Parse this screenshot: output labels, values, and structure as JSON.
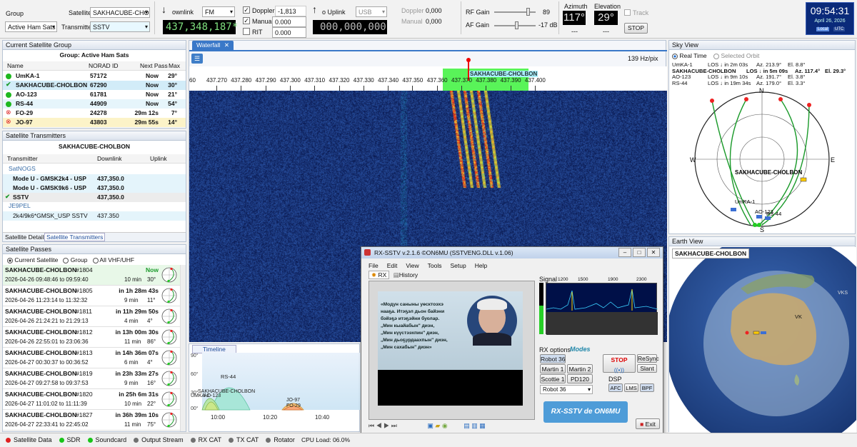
{
  "toolbar": {
    "group_label": "Group",
    "group_value": "Active Ham Sats",
    "satellite_label": "Satellite",
    "satellite_value": "SAKHACUBE-CHO",
    "transmitter_label": "Transmitter",
    "transmitter_value": "SSTV",
    "downlink_label": "ownlink",
    "downlink_mode": "FM",
    "downlink_freq": "437,348,187*",
    "doppler_label": "Doppler",
    "doppler_value": "-1,813",
    "manual_label": "Manual",
    "manual_value": "0.000",
    "rit_label": "RIT",
    "rit_value": "0.000",
    "uplink_label": "o Uplink",
    "uplink_mode": "USB",
    "uplink_freq": "000,000,000",
    "up_doppler_label": "Doppler",
    "up_doppler_value": "0,000",
    "up_manual_label": "Manual",
    "up_manual_value": "0,000",
    "rf_gain_label": "RF Gain",
    "rf_gain_value": "89",
    "af_gain_label": "AF Gain",
    "af_gain_value": "-17 dB",
    "rf_gain_level": 0.85,
    "af_gain_level": 0.55,
    "azimuth_label": "Azimuth",
    "azimuth_value": "117°",
    "azimuth_sub": "---",
    "elevation_label": "Elevation",
    "elevation_value": "29°",
    "elevation_sub": "---",
    "track_label": "Track",
    "stop_label": "STOP",
    "clock_time": "09:54:31",
    "clock_date": "April 26, 2026",
    "clock_local": "Local",
    "clock_utc": "UTC"
  },
  "sat_group": {
    "panel_title": "Current Satellite Group",
    "group_heading": "Group:  Active Ham Sats",
    "headers": [
      "Name",
      "NORAD ID",
      "Next Pass",
      "Max"
    ],
    "rows": [
      {
        "name": "UmKA-1",
        "norad": "57172",
        "next": "Now",
        "max": "29°",
        "status": "green"
      },
      {
        "name": "SAKHACUBE-CHOLBON",
        "norad": "67290",
        "next": "Now",
        "max": "30°",
        "status": "check"
      },
      {
        "name": "AO-123",
        "norad": "61781",
        "next": "Now",
        "max": "21°",
        "status": "green"
      },
      {
        "name": "RS-44",
        "norad": "44909",
        "next": "Now",
        "max": "54°",
        "status": "green"
      },
      {
        "name": "FO-29",
        "norad": "24278",
        "next": "29m 12s",
        "max": "7°",
        "status": "red"
      },
      {
        "name": "JO-97",
        "norad": "43803",
        "next": "29m 55s",
        "max": "14°",
        "status": "red"
      }
    ]
  },
  "transmitters": {
    "panel_title": "Satellite Transmitters",
    "sat_heading": "SAKHACUBE-CHOLBON",
    "headers": [
      "Transmitter",
      "Downlink",
      "Uplink"
    ],
    "group1": "SatNOGS",
    "rows1": [
      {
        "name": "Mode U - GMSK2k4 - USP",
        "down": "437,350.0"
      },
      {
        "name": "Mode U - GMSK9k6 - USP",
        "down": "437,350.0"
      },
      {
        "name": "SSTV",
        "down": "437,350.0"
      }
    ],
    "group2": "JE9PEL",
    "rows2": [
      {
        "name": "2k4/9k6*GMSK_USP SSTV",
        "down": "437.350"
      }
    ],
    "tab_details": "Satellite Details",
    "tab_transmitters": "Satellite Transmitters"
  },
  "passes": {
    "panel_title": "Satellite Passes",
    "radio_current": "Current Satellite",
    "radio_group": "Group",
    "radio_all": "All VHF/UHF",
    "items": [
      {
        "sat": "SAKHACUBE-CHOLBON",
        "num": "#1804",
        "when": "Now",
        "times": "2026-04-26 09:48:46  to  09:59:40",
        "dur": "10 min",
        "max": "30°"
      },
      {
        "sat": "SAKHACUBE-CHOLBON",
        "num": "#1805",
        "when": "in 1h 28m 43s",
        "times": "2026-04-26 11:23:14  to  11:32:32",
        "dur": "9 min",
        "max": "11°"
      },
      {
        "sat": "SAKHACUBE-CHOLBON",
        "num": "#1811",
        "when": "in 11h 29m 50s",
        "times": "2026-04-26 21:24:21  to  21:29:13",
        "dur": "4 min",
        "max": "4°"
      },
      {
        "sat": "SAKHACUBE-CHOLBON",
        "num": "#1812",
        "when": "in 13h 00m 30s",
        "times": "2026-04-26 22:55:01  to  23:06:36",
        "dur": "11 min",
        "max": "86°"
      },
      {
        "sat": "SAKHACUBE-CHOLBON",
        "num": "#1813",
        "when": "in 14h 36m 07s",
        "times": "2026-04-27 00:30:37  to  00:36:52",
        "dur": "6 min",
        "max": "4°"
      },
      {
        "sat": "SAKHACUBE-CHOLBON",
        "num": "#1819",
        "when": "in 23h 33m 27s",
        "times": "2026-04-27 09:27:58  to  09:37:53",
        "dur": "9 min",
        "max": "16°"
      },
      {
        "sat": "SAKHACUBE-CHOLBON",
        "num": "#1820",
        "when": "in 25h 6m 31s",
        "times": "2026-04-27 11:01:02  to  11:11:39",
        "dur": "10 min",
        "max": "22°"
      },
      {
        "sat": "SAKHACUBE-CHOLBON",
        "num": "#1827",
        "when": "in 36h 39m 10s",
        "times": "2026-04-27 22:33:41  to  22:45:02",
        "dur": "11 min",
        "max": "75°"
      }
    ]
  },
  "waterfall": {
    "tab": "Waterfall",
    "resolution": "139 Hz/pix",
    "marker": "SAKHACUBE-CHOLBON",
    "scale_start": "60",
    "scale": [
      "437.270",
      "437.280",
      "437.290",
      "437.300",
      "437.310",
      "437.320",
      "437.330",
      "437.340",
      "437.350",
      "437.360",
      "437.370",
      "437.380",
      "437.390",
      "437.400"
    ]
  },
  "timeline": {
    "tab": "Timeline",
    "y_labels": [
      "90°",
      "60°",
      "30°",
      "00°"
    ],
    "x_labels": [
      "10:00",
      "10:20",
      "10:40"
    ],
    "sat_labels": [
      "RS-44",
      "SAKHACUBE-CHOLBON",
      "UMKA-1",
      "AO-123",
      "JO-97",
      "FO-29"
    ]
  },
  "sky": {
    "panel_title": "Sky View",
    "real_time": "Real Time",
    "selected_orbit": "Selected Orbit",
    "lines": [
      {
        "name": "UmKA-1",
        "los": "LOS ↓  in 2m 03s",
        "az": "Az. 213.9°",
        "el": "El. 8.8°"
      },
      {
        "name": "SAKHACUBE-CHOLBON",
        "los": "LOS ↓  in 5m 09s",
        "az": "Az. 117.4°",
        "el": "El. 29.3°"
      },
      {
        "name": "AO-123",
        "los": "LOS ↓  in 9m 10s",
        "az": "Az. 191.7°",
        "el": "El. 3.8°"
      },
      {
        "name": "RS-44",
        "los": "LOS ↓  in 19m 34s",
        "az": "Az. 179.0°",
        "el": "El. 3.3°"
      }
    ],
    "n": "N",
    "e": "E",
    "s": "S",
    "w": "W",
    "label_main": "SAKHACUBE-CHOLBON",
    "label_umka": "UmKA-1",
    "label_ao": "AO-123",
    "label_rs": "RS-44"
  },
  "earth": {
    "panel_title": "Earth View",
    "sat_name": "SAKHACUBE-CHOLBON",
    "vk": "VK",
    "vks": "VKS"
  },
  "sstv": {
    "title": "RX-SSTV v.2.1.6 ©ON6MU (SSTVENG.DLL v.1.06)",
    "menu": [
      "File",
      "Edit",
      "View",
      "Tools",
      "Setup",
      "Help"
    ],
    "tab_rx": "RX",
    "tab_history": "History",
    "image_lines": [
      "«Модун саныны уөсктоэхэ",
      "нааҕа. Итэҕэл дьон байэни",
      "бэйэҕэ итэҕэйни буолар.",
      "„Мин кыайабын\" диэн,",
      "„Мин күүстээхпин\" диэн,",
      "„Мин дьоҕурдаахпын\" диэн,",
      "„Мин сахабын\" диэн»"
    ],
    "signal_label": "Signal",
    "freq_marks": [
      "1200",
      "1500",
      "1900",
      "2300"
    ],
    "rx_options": "RX options",
    "modes": "Modes",
    "mode_buttons": [
      "Robot 36",
      "Martin 1",
      "Martin 2",
      "Scottie 1",
      "PD120"
    ],
    "mode_selected": "Robot 36",
    "stop": "STOP",
    "resync": "ReSync",
    "slant": "Slant",
    "dsp": "DSP",
    "afc": "AFC",
    "lms": "LMS",
    "bpf": "BPF",
    "logo": "RX-SSTV de ON6MU",
    "exit": "Exit"
  },
  "status": {
    "items": [
      {
        "label": "Satellite Data",
        "color": "#e02020"
      },
      {
        "label": "SDR",
        "color": "#18c418"
      },
      {
        "label": "Soundcard",
        "color": "#18c418"
      },
      {
        "label": "Output Stream",
        "color": "#707070"
      },
      {
        "label": "RX CAT",
        "color": "#707070"
      },
      {
        "label": "TX CAT",
        "color": "#707070"
      },
      {
        "label": "Rotator",
        "color": "#707070"
      }
    ],
    "cpu": "CPU Load: 06.0%"
  }
}
